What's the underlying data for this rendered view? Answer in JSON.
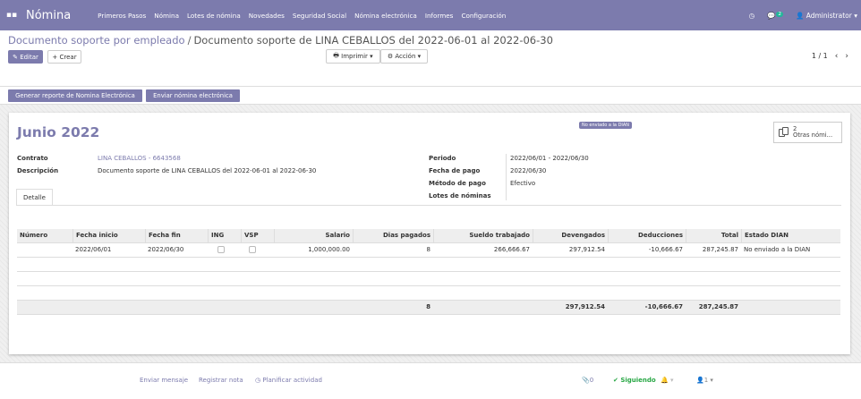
{
  "navbar": {
    "brand": "Nómina",
    "menu": [
      "Primeros Pasos",
      "Nómina",
      "Lotes de nómina",
      "Novedades",
      "Seguridad Social",
      "Nómina electrónica",
      "Informes",
      "Configuración"
    ],
    "chat_count": "2",
    "user": "Administrator"
  },
  "control_panel": {
    "breadcrumb_parent": "Documento soporte por empleado",
    "breadcrumb_current": "Documento soporte de LINA CEBALLOS del 2022-06-01 al 2022-06-30",
    "edit_label": "Editar",
    "create_label": "Crear",
    "print_label": "Imprimir",
    "action_label": "Acción",
    "pager": "1 / 1"
  },
  "header_buttons": {
    "generate": "Generar reporte de Nomina Electrónica",
    "send": "Enviar nómina electrónica"
  },
  "sheet": {
    "status_badge": "No enviado a la DIAN",
    "smart_button_count": "2",
    "smart_button_label": "Otras nómi...",
    "title": "Junio 2022",
    "fields_left": [
      {
        "label": "Contrato",
        "value": "LINA CEBALLOS - 6643568"
      },
      {
        "label": "Descripción",
        "value": "Documento soporte de LINA CEBALLOS del 2022-06-01 al 2022-06-30"
      }
    ],
    "fields_right": [
      {
        "label": "Periodo",
        "value": "2022/06/01 - 2022/06/30"
      },
      {
        "label": "Fecha de pago",
        "value": "2022/06/30"
      },
      {
        "label": "Método de pago",
        "value": "Efectivo"
      },
      {
        "label": "Lotes de nóminas",
        "value": ""
      }
    ],
    "tab_label": "Detalle"
  },
  "table": {
    "columns": [
      "Número",
      "Fecha inicio",
      "Fecha fin",
      "ING",
      "VSP",
      "Salario",
      "Dias pagados",
      "Sueldo trabajado",
      "Devengados",
      "Deducciones",
      "Total",
      "Estado DIAN"
    ],
    "rows": [
      {
        "numero": "",
        "fecha_inicio": "2022/06/01",
        "fecha_fin": "2022/06/30",
        "ing": false,
        "vsp": false,
        "salario": "1,000,000.00",
        "dias": "8",
        "sueldo": "266,666.67",
        "devengados": "297,912.54",
        "deducciones": "-10,666.67",
        "total": "287,245.87",
        "estado": "No enviado a la DIAN"
      }
    ],
    "footer": {
      "dias": "8",
      "devengados": "297,912.54",
      "deducciones": "-10,666.67",
      "total": "287,245.87"
    }
  },
  "chatter": {
    "send_message": "Enviar mensaje",
    "log_note": "Registrar nota",
    "schedule": "Planificar actividad",
    "attachments": "0",
    "following": "Siguiendo",
    "followers": "1"
  },
  "colors": {
    "brand": "#7c7bad",
    "following": "#28a745"
  }
}
